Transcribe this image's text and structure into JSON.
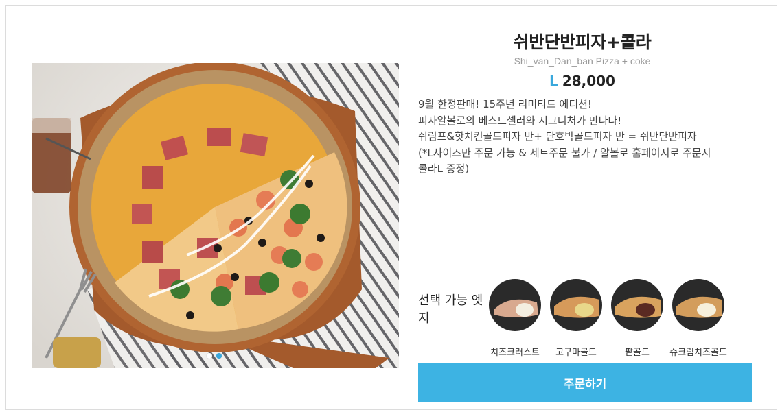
{
  "product": {
    "name": "쉬반단반피자+콜라",
    "name_en": "Shi_van_Dan_ban Pizza + coke",
    "price_size": "L",
    "price_value": "28,000"
  },
  "description": {
    "lines": [
      "9월 한정판매! 15주년 리미티드 에디션!",
      "피자알볼로의 베스트셀러와 시그니처가 만나다!",
      "쉬림프&핫치킨골드피자 반+ 단호박골드피자 반 = 쉬반단반피자",
      "(*L사이즈만 주문 가능 & 세트주문 불가 / 알볼로 홈페이지로 주문시",
      "콜라L 증정)"
    ]
  },
  "carousel": {
    "slide_count": 2,
    "active_index": 1,
    "colors": {
      "active_dot": "#3aa8dc",
      "inactive_dot": "#ffffff"
    }
  },
  "edges": {
    "label": "선택 가능 엣지",
    "items": [
      {
        "name": "치즈크러스트",
        "filling": "#f3eee0",
        "icon": "cheese-crust-thumb"
      },
      {
        "name": "고구마골드",
        "filling": "#e8d88a",
        "icon": "sweet-potato-gold-thumb"
      },
      {
        "name": "팥골드",
        "filling": "#5a2a22",
        "icon": "red-bean-gold-thumb"
      },
      {
        "name": "슈크림치즈골드",
        "filling": "#f6f0dc",
        "icon": "cream-cheese-gold-thumb"
      }
    ]
  },
  "order_button": {
    "label": "주문하기",
    "color": "#3db3e3"
  }
}
